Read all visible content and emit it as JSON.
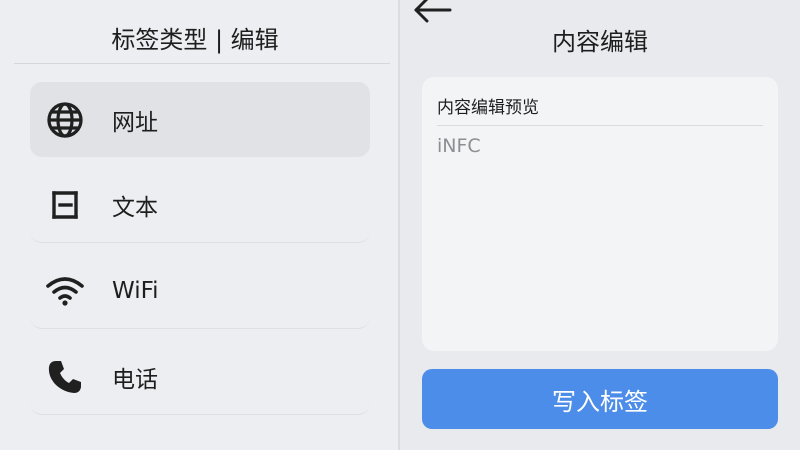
{
  "left_panel": {
    "title": "标签类型 | 编辑",
    "items": [
      {
        "label": "网址",
        "icon": "globe-icon",
        "selected": true
      },
      {
        "label": "文本",
        "icon": "text-document-icon",
        "selected": false
      },
      {
        "label": "WiFi",
        "icon": "wifi-icon",
        "selected": false
      },
      {
        "label": "电话",
        "icon": "phone-icon",
        "selected": false
      }
    ]
  },
  "right_panel": {
    "back_icon": "arrow-left-icon",
    "title": "内容编辑",
    "editor": {
      "label": "内容编辑预览",
      "placeholder": "iNFC",
      "value": ""
    },
    "write_button_label": "写入标签"
  },
  "colors": {
    "accent": "#4b8de8",
    "icon": "#202020"
  }
}
